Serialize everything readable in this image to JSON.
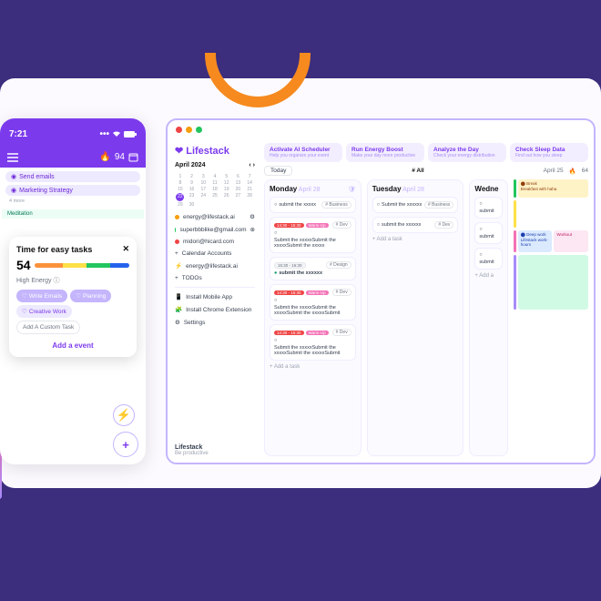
{
  "phone": {
    "time": "7:21",
    "streak_count": "94",
    "strips": [
      "Send emails",
      "Marketing Strategy"
    ],
    "more": "4 more",
    "meditation": "Meditation",
    "modal": {
      "title": "Time for easy tasks",
      "score": "54",
      "energy_label": "High Energy",
      "chips": [
        "Write Emails",
        "Planning",
        "Creative Work"
      ],
      "custom_chip": "Add A Custom Task",
      "cta": "Add a event"
    }
  },
  "desktop": {
    "brand": "Lifestack",
    "month_label": "April 2024",
    "calendar_days": [
      "1",
      "2",
      "3",
      "4",
      "5",
      "6",
      "7",
      "8",
      "9",
      "10",
      "11",
      "12",
      "13",
      "14",
      "15",
      "16",
      "17",
      "18",
      "19",
      "20",
      "21",
      "22",
      "23",
      "24",
      "25",
      "26",
      "27",
      "28",
      "29",
      "30"
    ],
    "today_num": "22",
    "accounts": [
      {
        "color": "#f59e0b",
        "label": "energy@lifestack.ai"
      },
      {
        "color": "#22c55e",
        "label": "superbbblike@gmail.com"
      },
      {
        "color": "#ef4444",
        "label": "midori@hicard.com"
      }
    ],
    "side_links": [
      "Calendar Accounts",
      "energy@lifestack.ai",
      "TODOs",
      "Install Mobile App",
      "Install Chrome Extension",
      "Settings"
    ],
    "footer": {
      "h": "Lifestack",
      "s": "Be productive"
    },
    "quick": [
      {
        "t": "Activate AI Scheduler",
        "s": "Help you organize your event"
      },
      {
        "t": "Run Energy Boost",
        "s": "Make your day more productive"
      },
      {
        "t": "Analyze the Day",
        "s": "Check your energy distribution"
      },
      {
        "t": "Check Sleep Data",
        "s": "Find out how you sleep"
      }
    ],
    "toolbar": {
      "today": "Today",
      "all": "# All",
      "date": "April 25",
      "streak": "64"
    },
    "columns": {
      "mon": {
        "name": "Monday",
        "date": "April 28",
        "tag_biz": "# Business",
        "tag_dev": "# Dev",
        "tag_design": "# Design",
        "t1": "submit the xxxxx",
        "t2_badge1": "14:30 - 15:30",
        "t2_badge2": "Warm-Up",
        "t2": "Submit the xxxxxSubmit the xxxxxSubmit the xxxxx",
        "t3_badge1": "15:30 - 16:30",
        "t3": "submit the xxxxxx",
        "t4_badge1": "14:30 - 15:30",
        "t4_badge2": "Warm-Up",
        "t4": "Submit the xxxxxSubmit the xxxxxSubmit the xxxxxSubmit",
        "t5_badge1": "14:30 - 15:30",
        "t5_badge2": "Warm-Up",
        "t5": "Submit the xxxxxSubmit the xxxxxSubmit the xxxxxSubmit",
        "add": "+ Add a task"
      },
      "tue": {
        "name": "Tuesday",
        "date": "April 28",
        "tag": "# Business",
        "t1": "Submit the xxxxxx",
        "t2": "submit the xxxxxx",
        "add": "+ Add a task"
      },
      "wed": {
        "name": "Wedne",
        "t1": "submit",
        "t2": "submit",
        "t3": "submit",
        "add": "+ Add a"
      }
    },
    "agenda": {
      "break": "Break",
      "breakfast": "Breakfast with haha",
      "deep": "Deep work",
      "hours": "Lifestack work-hours",
      "workout": "Workout"
    }
  }
}
